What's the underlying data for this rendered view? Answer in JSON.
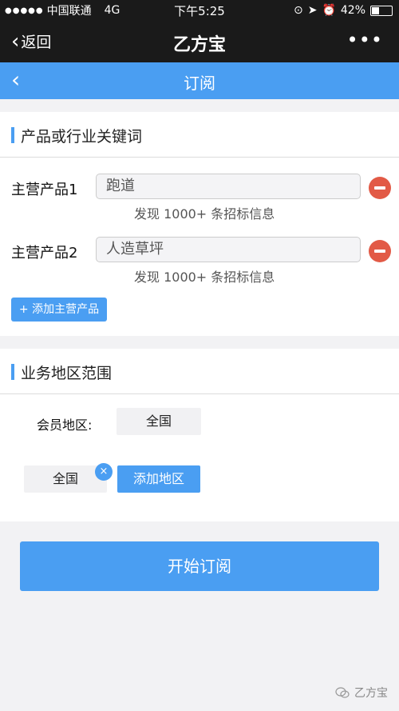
{
  "status_bar": {
    "signal": "●●●●●",
    "carrier": "中国联通",
    "network": "4G",
    "time": "下午5:25",
    "battery": "42%",
    "battery_level": 0.42
  },
  "wechat_bar": {
    "back_label": "返回",
    "title": "乙方宝",
    "more": "•••"
  },
  "page_header": {
    "back_glyph": "‹",
    "title": "订阅"
  },
  "keywords_section": {
    "title": "产品或行业关键词",
    "products": [
      {
        "label": "主营产品1",
        "value": "跑道",
        "found": "发现 1000+ 条招标信息"
      },
      {
        "label": "主营产品2",
        "value": "人造草坪",
        "found": "发现 1000+ 条招标信息"
      }
    ],
    "add_button": "+ 添加主营产品"
  },
  "region_section": {
    "title": "业务地区范围",
    "member_label": "会员地区:",
    "member_value": "全国",
    "selected_region": "全国",
    "remove_glyph": "×",
    "add_button": "添加地区"
  },
  "subscribe_button": "开始订阅",
  "watermark": "乙方宝",
  "colors": {
    "accent": "#4a9ef2",
    "remove": "#e25a46",
    "topbar": "#1a1a1a"
  }
}
